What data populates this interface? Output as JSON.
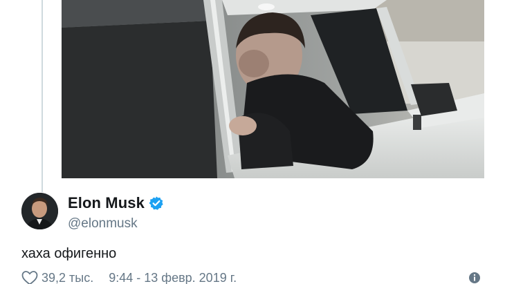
{
  "tweet": {
    "author": {
      "display_name": "Elon Musk",
      "handle": "@elonmusk",
      "verified_icon": "verified-badge-icon",
      "avatar": "profile-photo"
    },
    "text": "хаха офигенно",
    "likes": "39,2 тыс.",
    "timestamp": "9:44 - 13 февр. 2019 г.",
    "like_icon": "heart-icon",
    "info_icon": "info-icon",
    "media": "video-still-man-in-car-window"
  },
  "colors": {
    "text": "#14171a",
    "secondary": "#657786",
    "verified": "#1da1f2",
    "thread_line": "#cfd9de"
  }
}
